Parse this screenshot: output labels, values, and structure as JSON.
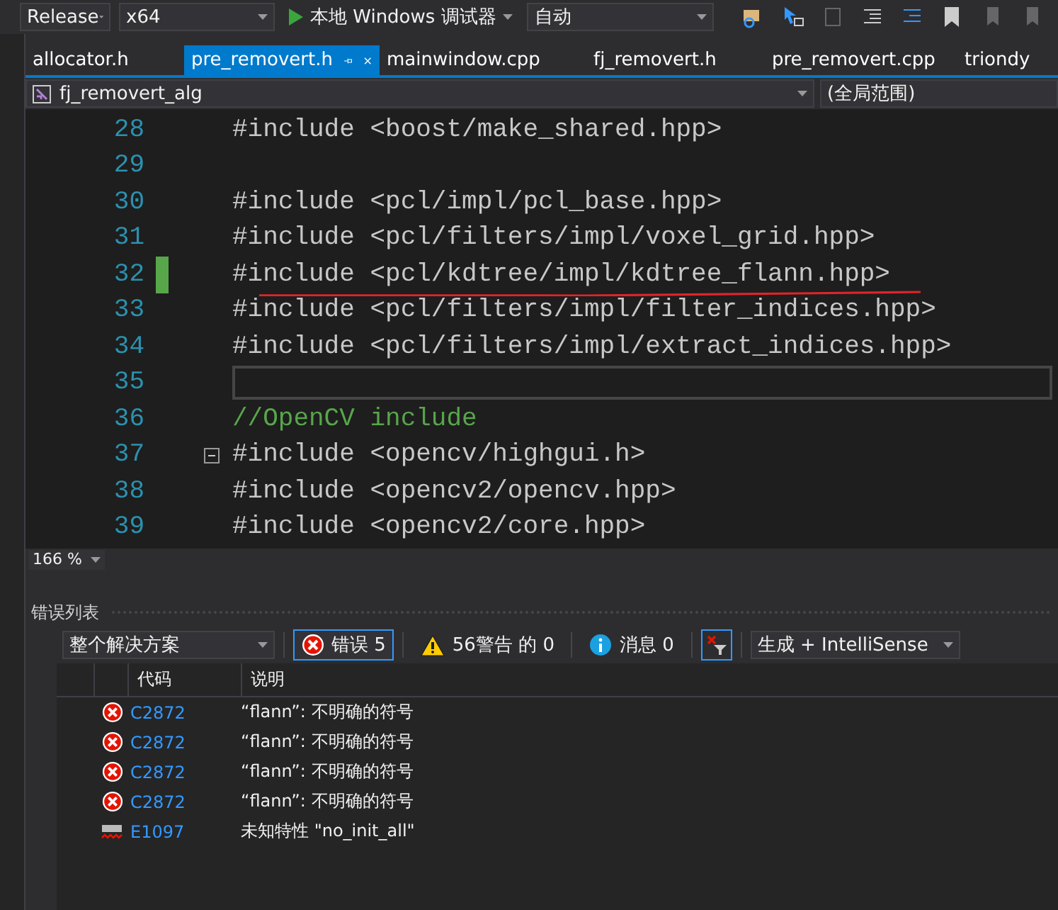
{
  "toolbar": {
    "configuration": "Release",
    "platform": "x64",
    "debugger": "本地 Windows 调试器",
    "mode": "自动"
  },
  "tabs": [
    {
      "label": "allocator.h",
      "selected": false
    },
    {
      "label": "pre_removert.h",
      "selected": true
    },
    {
      "label": "mainwindow.cpp",
      "selected": false
    },
    {
      "label": "fj_removert.h",
      "selected": false
    },
    {
      "label": "pre_removert.cpp",
      "selected": false
    },
    {
      "label": "triondy",
      "selected": false
    }
  ],
  "navigation": {
    "scope": "fj_removert_alg",
    "global": "(全局范围)"
  },
  "editor": {
    "lines": [
      {
        "number": "28",
        "kind": "code",
        "text": "#include <boost/make_shared.hpp>",
        "modified": false,
        "current": false,
        "collapsible": false
      },
      {
        "number": "29",
        "kind": "blank",
        "modified": false,
        "current": false,
        "collapsible": false
      },
      {
        "number": "30",
        "kind": "code",
        "text": "#include <pcl/impl/pcl_base.hpp>",
        "modified": false,
        "current": false,
        "collapsible": false
      },
      {
        "number": "31",
        "kind": "code",
        "text": "#include <pcl/filters/impl/voxel_grid.hpp>",
        "modified": false,
        "current": false,
        "collapsible": false
      },
      {
        "number": "32",
        "kind": "code",
        "text": "#include <pcl/kdtree/impl/kdtree_flann.hpp>",
        "modified": true,
        "current": false,
        "collapsible": false
      },
      {
        "number": "33",
        "kind": "code",
        "text": "#include <pcl/filters/impl/filter_indices.hpp>",
        "modified": false,
        "current": false,
        "collapsible": false
      },
      {
        "number": "34",
        "kind": "code",
        "text": "#include <pcl/filters/impl/extract_indices.hpp>",
        "modified": false,
        "current": false,
        "collapsible": false
      },
      {
        "number": "35",
        "kind": "blank",
        "modified": false,
        "current": true,
        "collapsible": false
      },
      {
        "number": "36",
        "kind": "comment",
        "text": "//OpenCV include",
        "modified": false,
        "current": false,
        "collapsible": false
      },
      {
        "number": "37",
        "kind": "code",
        "text": "#include <opencv/highgui.h>",
        "modified": false,
        "current": false,
        "collapsible": true
      },
      {
        "number": "38",
        "kind": "code",
        "text": "#include <opencv2/opencv.hpp>",
        "modified": false,
        "current": false,
        "collapsible": false
      },
      {
        "number": "39",
        "kind": "code",
        "text": "#include <opencv2/core.hpp>",
        "modified": false,
        "current": false,
        "collapsible": false
      }
    ],
    "zoom": "166 %"
  },
  "error_list": {
    "title": "错误列表",
    "scope": "整个解决方案",
    "filters": [
      {
        "kind": "error",
        "label": "错误 5",
        "selected": true
      },
      {
        "kind": "warning",
        "label": "56警告 的 0",
        "selected": false
      },
      {
        "kind": "info",
        "label": "消息 0",
        "selected": false
      }
    ],
    "filter_toggle": {
      "on": true
    },
    "source": "生成 + IntelliSense",
    "columns": [
      "代码",
      "说明"
    ],
    "rows": [
      {
        "kind": "error",
        "code": "C2872",
        "description": "“flann”: 不明确的符号"
      },
      {
        "kind": "error",
        "code": "C2872",
        "description": "“flann”: 不明确的符号"
      },
      {
        "kind": "error",
        "code": "C2872",
        "description": "“flann”: 不明确的符号"
      },
      {
        "kind": "error",
        "code": "C2872",
        "description": "“flann”: 不明确的符号"
      },
      {
        "kind": "spelling",
        "code": "E1097",
        "description": "未知特性 \"no_init_all\""
      }
    ]
  }
}
